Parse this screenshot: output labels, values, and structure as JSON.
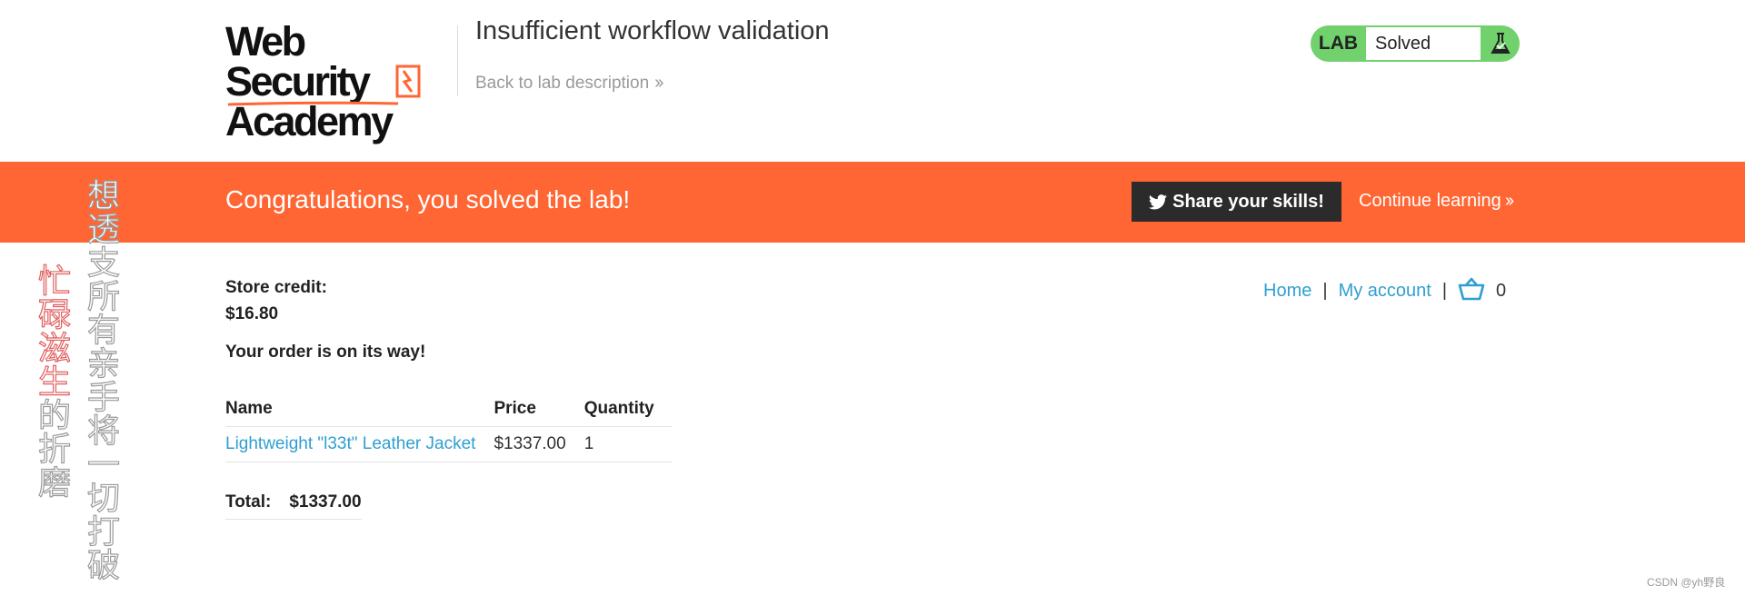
{
  "header": {
    "logo_line1": "Web Security",
    "logo_line2": "Academy",
    "lab_title": "Insufficient workflow validation",
    "back_link": "Back to lab description",
    "lab_status": {
      "tag": "LAB",
      "status": "Solved",
      "color": "#70d16d"
    }
  },
  "banner": {
    "message": "Congratulations, you solved the lab!",
    "share_button": "Share your skills!",
    "continue_link": "Continue learning",
    "color": "#ff6633"
  },
  "nav": {
    "home": "Home",
    "separator": "|",
    "my_account": "My account",
    "cart_count": "0"
  },
  "store": {
    "credit_label": "Store credit:",
    "credit_value": "$16.80",
    "order_message": "Your order is on its way!"
  },
  "order_table": {
    "headers": [
      "Name",
      "Price",
      "Quantity"
    ],
    "rows": [
      {
        "name": "Lightweight \"l33t\" Leather Jacket",
        "price": "$1337.00",
        "quantity": "1"
      }
    ]
  },
  "total": {
    "label": "Total:",
    "value": "$1337.00"
  },
  "overlay": {
    "right_column": "想透支所有亲手将一切打破",
    "left_column_red": "忙碌滋生",
    "left_column_grey": "的折磨",
    "watermark": "CSDN @yh野良"
  },
  "colors": {
    "link": "#2f9fd0",
    "accent": "#ff6633",
    "solved": "#70d16d"
  }
}
